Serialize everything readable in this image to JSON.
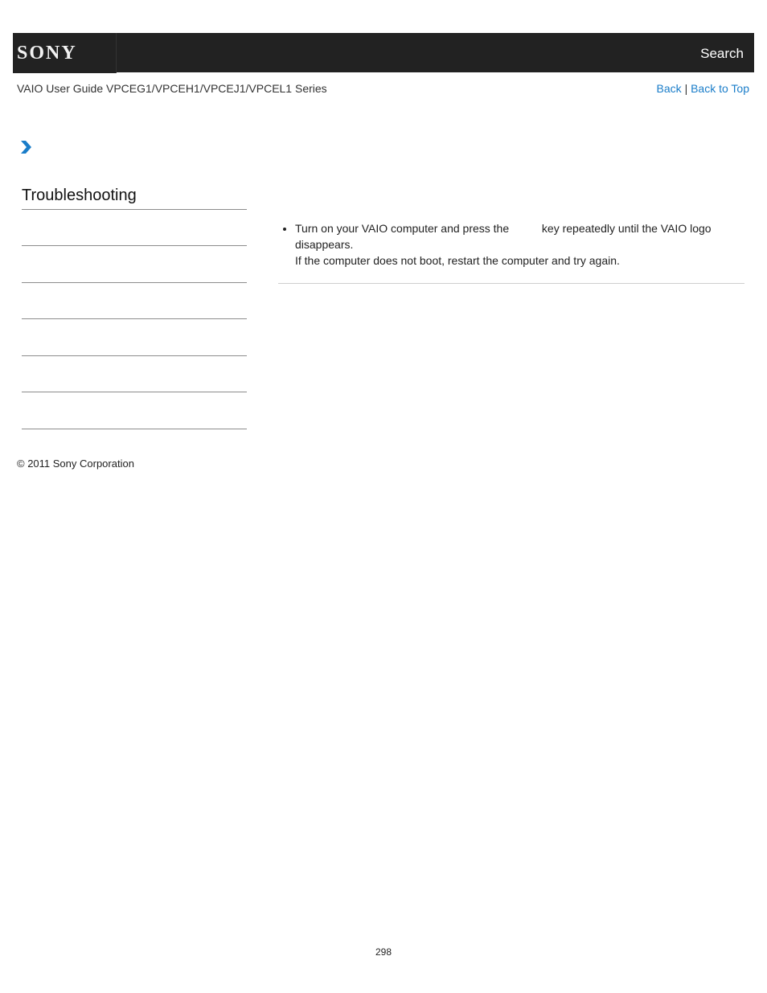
{
  "header": {
    "logo_text": "SONY",
    "search_label": "Search"
  },
  "subheader": {
    "guide_title": "VAIO User Guide VPCEG1/VPCEH1/VPCEJ1/VPCEL1 Series",
    "back_label": "Back",
    "separator": "|",
    "back_to_top_label": "Back to Top"
  },
  "sidebar": {
    "section_title": "Troubleshooting",
    "items": [
      "",
      "",
      "",
      "",
      "",
      ""
    ]
  },
  "content": {
    "bullet_text_before_key": "Turn on your VAIO computer and press the",
    "bullet_text_after_key": "key repeatedly until the VAIO logo disappears.",
    "bullet_followup": "If the computer does not boot, restart the computer and try again."
  },
  "footer": {
    "copyright": "© 2011 Sony Corporation",
    "page_number": "298"
  },
  "colors": {
    "header_bg": "#222222",
    "link": "#1a7dc9",
    "chevron": "#1a7dc9"
  }
}
